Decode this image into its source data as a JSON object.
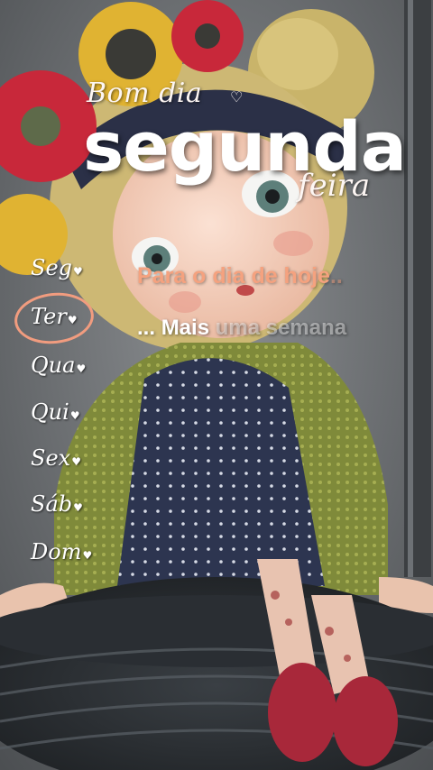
{
  "title": {
    "greeting": "Bom dia",
    "day": "segunda",
    "suffix": "feira"
  },
  "weekdays": [
    "Seg",
    "Ter",
    "Qua",
    "Qui",
    "Sex",
    "Sáb",
    "Dom"
  ],
  "highlighted_day": "Ter",
  "caption": {
    "line1_main": "Para o dia de hoje",
    "line1_trail": "..",
    "line2_lead": "...",
    "line2_main": "Mais",
    "line2_fade": "uma semana"
  },
  "colors": {
    "accent": "#f5a27f",
    "circle": "#f19c7f",
    "text": "#ffffff"
  },
  "scene_icons": [
    "sunflower-icon",
    "red-flower-icon",
    "doll-figure",
    "tire-swing"
  ]
}
